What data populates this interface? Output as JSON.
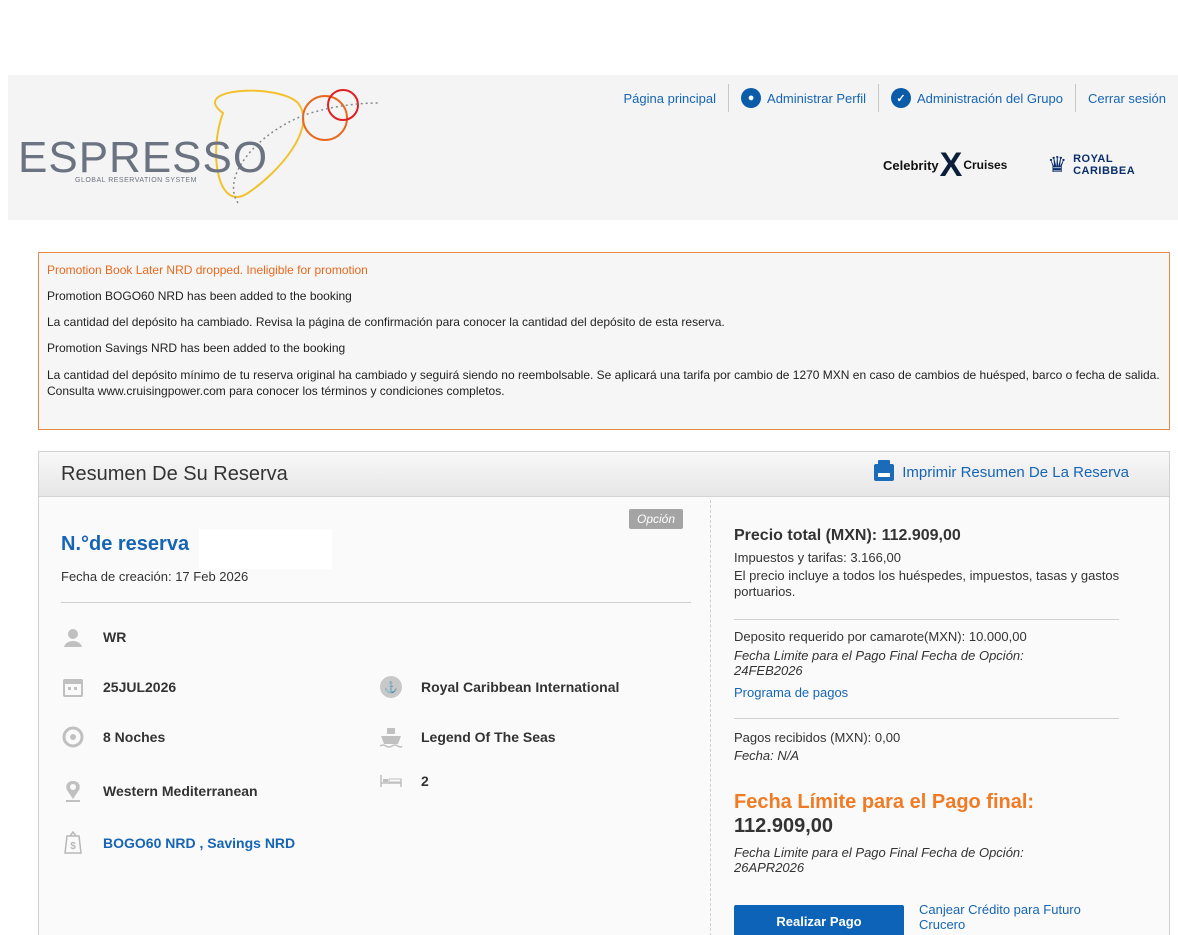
{
  "header": {
    "logo_text": "ESPRESSO",
    "logo_subtitle": "GLOBAL RESERVATION SYSTEM",
    "nav": {
      "home": "Página principal",
      "profile": "Administrar Perfil",
      "group": "Administración del Grupo",
      "logout": "Cerrar sesión"
    },
    "brands": {
      "celebrity_left": "Celebrity",
      "celebrity_right": "Cruises",
      "royal_line1": "ROYAL",
      "royal_line2": "CARIBBEA"
    }
  },
  "alerts": [
    "Promotion Book Later NRD dropped. Ineligible for promotion",
    "Promotion BOGO60 NRD has been added to the booking",
    "La cantidad del depósito ha cambiado. Revisa la página de confirmación para conocer la cantidad del depósito de esta reserva.",
    "Promotion Savings NRD has been added to the booking",
    "La cantidad del depósito mínimo de tu reserva original ha cambiado y seguirá siendo no reembolsable. Se aplicará una tarifa por cambio de 1270 MXN en caso de cambios de huésped, barco o fecha de salida. Consulta www.cruisingpower.com para conocer los términos y condiciones completos."
  ],
  "summary": {
    "title": "Resumen De Su Reserva",
    "print_label": "Imprimir Resumen De La Reserva",
    "badge": "Opción",
    "reservation_label": "N.°de reserva",
    "created_label": "Fecha de creación:",
    "created_value": "17 Feb 2026",
    "details": {
      "code": "WR",
      "date": "25JUL2026",
      "nights": "8 Noches",
      "itinerary": "Western Mediterranean",
      "promos": "BOGO60 NRD , Savings NRD",
      "line": "Royal Caribbean International",
      "ship": "Legend Of The Seas",
      "guests": "2"
    }
  },
  "pricing": {
    "total_label": "Precio total (MXN): 112.909,00",
    "taxes": "Impuestos y tarifas: 3.166,00",
    "includes": "El precio incluye a todos los huéspedes, impuestos, tasas y gastos portuarios.",
    "deposit_label": "Deposito requerido por camarote(MXN):",
    "deposit_value": "10.000,00",
    "deposit_deadline_label": "Fecha Limite para el Pago Final Fecha de Opción:",
    "deposit_deadline_value": "24FEB2026",
    "schedule_link": "Programa de pagos",
    "received_label": "Pagos recibidos (MXN):",
    "received_value": "0,00",
    "date_label": "Fecha:",
    "date_value": "N/A",
    "final_title": "Fecha Límite para el Pago final:",
    "final_amount": "112.909,00",
    "final_deadline_label": "Fecha Limite para el Pago Final Fecha de Opción:",
    "final_deadline_value": "26APR2026",
    "pay_button": "Realizar Pago",
    "redeem_link": "Canjear Crédito para Futuro Crucero"
  }
}
